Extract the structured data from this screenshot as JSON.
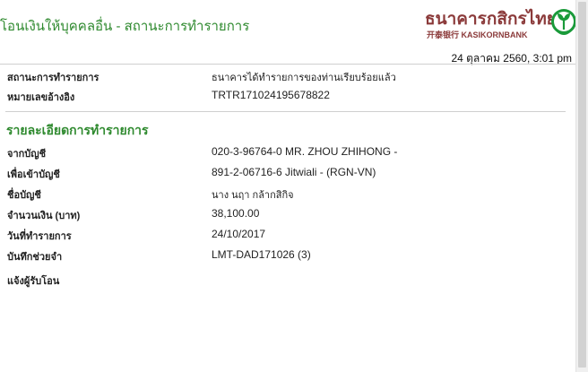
{
  "header": {
    "title": "โอนเงินให้บุคคลอื่น - สถานะการทำรายการ",
    "bank_name_thai": "ธนาคารกสิกรไทย",
    "bank_name_en": "开泰银行 KASIKORNBANK",
    "logo_icon": "kasikornbank-leaf-icon",
    "datetime": "24 ตุลาคม 2560, 3:01 pm"
  },
  "status": {
    "rows": [
      {
        "label": "สถานะการทำรายการ",
        "value": "ธนาคารได้ทำรายการของท่านเรียบร้อยแล้ว"
      },
      {
        "label": "หมายเลขอ้างอิง",
        "value": "TRTR171024195678822"
      }
    ]
  },
  "details": {
    "title": "รายละเอียดการทำรายการ",
    "rows": [
      {
        "label": "จากบัญชี",
        "value": "020-3-96764-0 MR. ZHOU ZHIHONG -"
      },
      {
        "label": "เพื่อเข้าบัญชี",
        "value": "891-2-06716-6 Jitwiali - (RGN-VN)"
      },
      {
        "label": "ชื่อบัญชี",
        "value": "นาง นฤา กล้ากสิกิจ"
      },
      {
        "label": "จำนวนเงิน (บาท)",
        "value": "38,100.00"
      },
      {
        "label": "วันที่ทำรายการ",
        "value": "24/10/2017"
      },
      {
        "label": "บันทึกช่วยจำ",
        "value": "LMT-DAD171026 (3)"
      },
      {
        "label": "แจ้งผู้รับโอน",
        "value": ""
      }
    ]
  },
  "colors": {
    "accent_green": "#2f8a2f",
    "brand_maroon": "#8b3a3a",
    "logo_green": "#1a9a3a"
  }
}
